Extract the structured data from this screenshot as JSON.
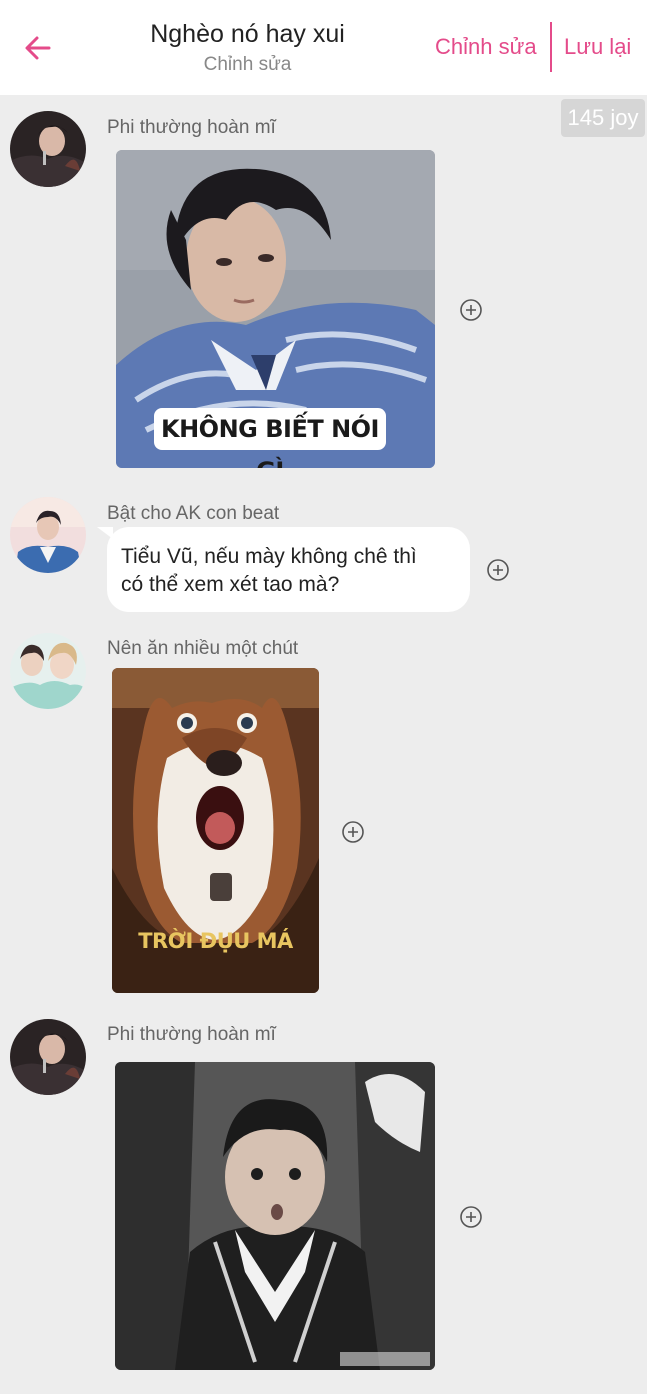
{
  "header": {
    "title": "Nghèo nó hay xui",
    "subtitle": "Chỉnh sửa",
    "edit_label": "Chỉnh sửa",
    "save_label": "Lưu lại",
    "accent_color": "#e44b8a"
  },
  "joy_badge": "145 joy",
  "messages": [
    {
      "sender": "Phi thường hoàn mĩ",
      "type": "sticker",
      "caption": "KHÔNG BIẾT NÓI GÌ"
    },
    {
      "sender": "Bật cho AK con beat",
      "type": "text",
      "line1": "Tiểu Vũ, nếu mày không chê thì",
      "line2": "có thể xem xét tao mà?"
    },
    {
      "sender": "Nên ăn nhiều một chút",
      "type": "sticker",
      "caption": "TRỜI ĐỤU MÁ"
    },
    {
      "sender": "Phi thường hoàn mĩ",
      "type": "sticker",
      "caption": ""
    }
  ],
  "icons": {
    "back": "arrow-left-icon",
    "add": "plus-circle-icon"
  }
}
